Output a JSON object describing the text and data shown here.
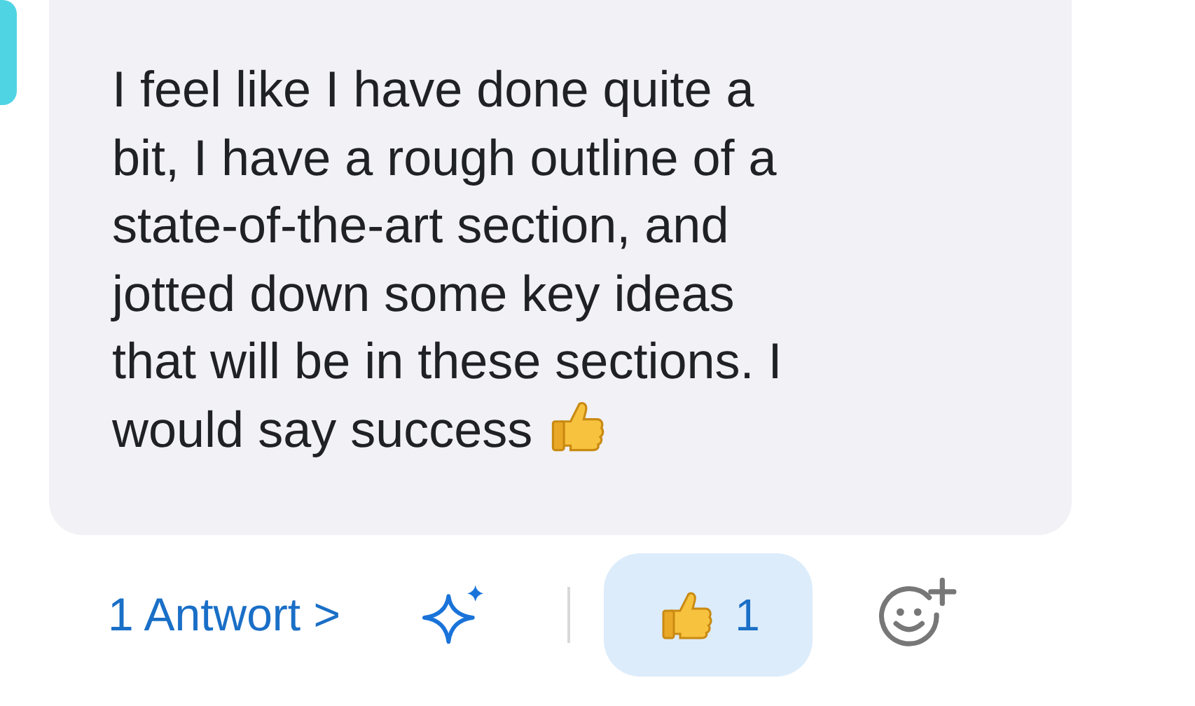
{
  "message": {
    "text": "I feel like I have done quite a\nbit, I have a rough outline of a\nstate-of-the-art section, and\njotted down some key ideas\nthat will be in these sections. I\nwould say success"
  },
  "replies": {
    "label": "1 Antwort >"
  },
  "reactions": [
    {
      "count": "1",
      "selected": true
    }
  ]
}
